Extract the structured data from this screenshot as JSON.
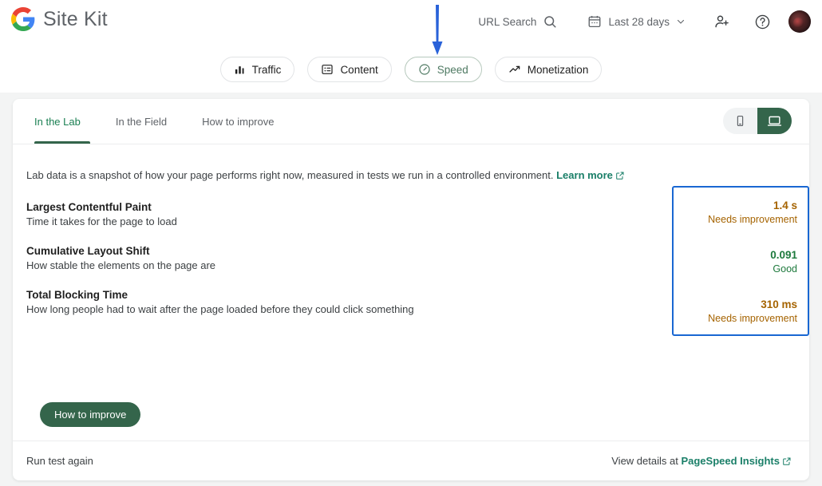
{
  "brand": {
    "name": "Site Kit",
    "logo_icon": "google-g-logo"
  },
  "header": {
    "url_search": {
      "label": "URL Search",
      "icon": "search-icon"
    },
    "date_range": {
      "label": "Last 28 days",
      "icon": "calendar-icon",
      "chevron": "chevron-down-icon"
    },
    "add_user_icon": "person-add-icon",
    "help_icon": "help-circle-icon",
    "avatar": "user-avatar"
  },
  "nav_tabs": [
    {
      "label": "Traffic",
      "icon": "bar-chart-icon",
      "active": false
    },
    {
      "label": "Content",
      "icon": "article-list-icon",
      "active": false
    },
    {
      "label": "Speed",
      "icon": "speedometer-icon",
      "active": true
    },
    {
      "label": "Monetization",
      "icon": "trending-up-icon",
      "active": false
    }
  ],
  "annotation": {
    "type": "blue-down-arrow",
    "points_to": "Speed",
    "color": "#2962d9"
  },
  "subtabs": [
    {
      "label": "In the Lab",
      "active": true
    },
    {
      "label": "In the Field",
      "active": false
    },
    {
      "label": "How to improve",
      "active": false
    }
  ],
  "device_toggle": {
    "mobile": {
      "icon": "mobile-phone-icon",
      "active": false
    },
    "desktop": {
      "icon": "desktop-laptop-icon",
      "active": true
    }
  },
  "lab_description": {
    "text": "Lab data is a snapshot of how your page performs right now, measured in tests we run in a controlled environment.",
    "link_label": "Learn more",
    "link_icon": "external-link-icon"
  },
  "metrics": [
    {
      "title": "Largest Contentful Paint",
      "description": "Time it takes for the page to load",
      "value": "1.4 s",
      "status": "Needs improvement",
      "status_color": "#a56300"
    },
    {
      "title": "Cumulative Layout Shift",
      "description": "How stable the elements on the page are",
      "value": "0.091",
      "status": "Good",
      "status_color": "#1e7a3d"
    },
    {
      "title": "Total Blocking Time",
      "description": "How long people had to wait after the page loaded before they could click something",
      "value": "310 ms",
      "status": "Needs improvement",
      "status_color": "#a56300"
    }
  ],
  "values_box_highlight_color": "#1967d2",
  "improve_button": {
    "label": "How to improve"
  },
  "footer": {
    "run_again_label": "Run test again",
    "view_details_prefix": "View details at ",
    "view_details_link": "PageSpeed Insights",
    "external_icon": "external-link-icon"
  }
}
